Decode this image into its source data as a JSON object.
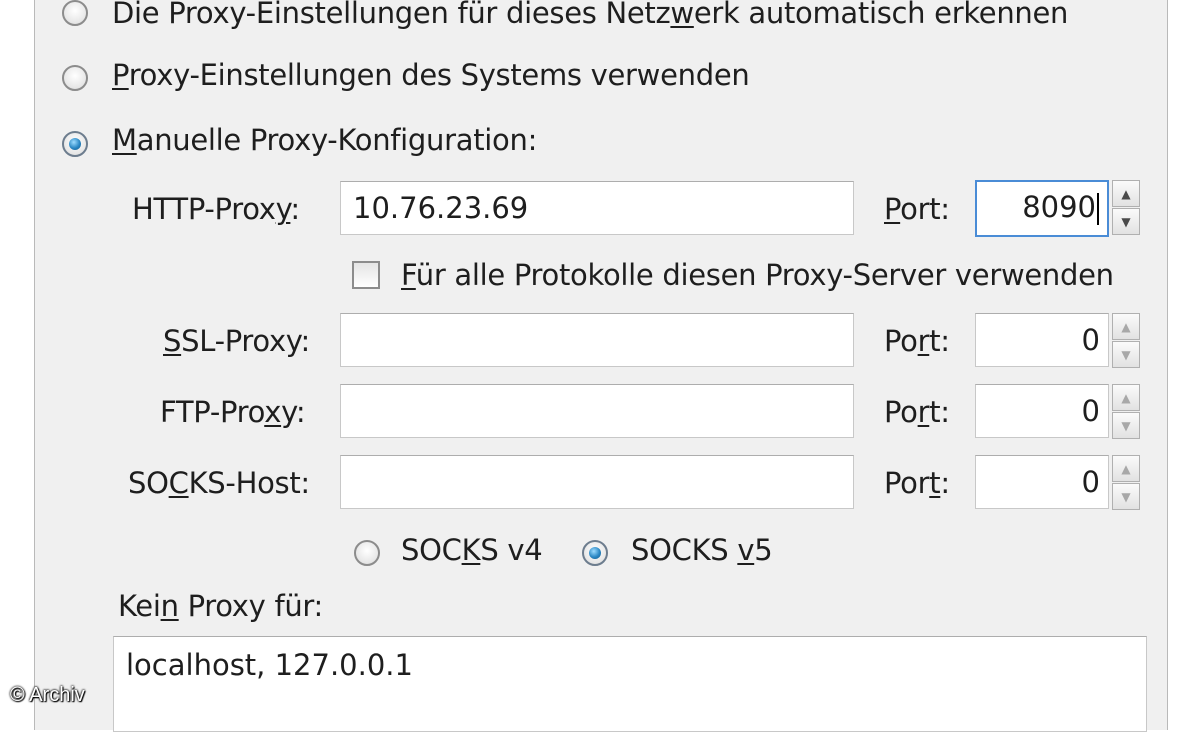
{
  "options": {
    "auto_detect": {
      "parts": [
        "Die Proxy-Einstellungen für dieses Netz",
        "w",
        "erk automatisch erkennen"
      ],
      "selected": false
    },
    "system": {
      "parts": [
        "",
        "P",
        "roxy-Einstellungen des Systems verwenden"
      ],
      "selected": false
    },
    "manual": {
      "parts": [
        "",
        "M",
        "anuelle Proxy-Konfiguration:"
      ],
      "selected": true
    }
  },
  "http": {
    "label_parts": [
      "HTTP-Prox",
      "y",
      ":"
    ],
    "value": "10.76.23.69",
    "port_label_parts": [
      "",
      "P",
      "ort:"
    ],
    "port": "8090"
  },
  "share_all": {
    "parts": [
      "",
      "F",
      "ür alle Protokolle diesen Proxy-Server verwenden"
    ],
    "checked": false
  },
  "ssl": {
    "label_parts": [
      "",
      "S",
      "SL-Proxy:"
    ],
    "value": "",
    "port_label_parts": [
      "Po",
      "r",
      "t:"
    ],
    "port": "0"
  },
  "ftp": {
    "label_parts": [
      "FTP-Pro",
      "x",
      "y:"
    ],
    "value": "",
    "port_label_parts": [
      "Po",
      "r",
      "t:"
    ],
    "port": "0"
  },
  "socks": {
    "label_parts": [
      "SO",
      "C",
      "KS-Host:"
    ],
    "value": "",
    "port_label_parts": [
      "Por",
      "t",
      ":"
    ],
    "port": "0"
  },
  "socks_version": {
    "v4_parts": [
      "SOC",
      "K",
      "S v4"
    ],
    "v5_parts": [
      "SOCKS ",
      "v",
      "5"
    ],
    "selected": "v5"
  },
  "no_proxy": {
    "label_parts": [
      "Kei",
      "n",
      " Proxy für:"
    ],
    "value": "localhost, 127.0.0.1"
  },
  "watermark": "© Archiv",
  "colors": {
    "panel_bg": "#f0f0f0",
    "focus_border": "#4a8cd6",
    "radio_dot": "#2a87c4"
  }
}
